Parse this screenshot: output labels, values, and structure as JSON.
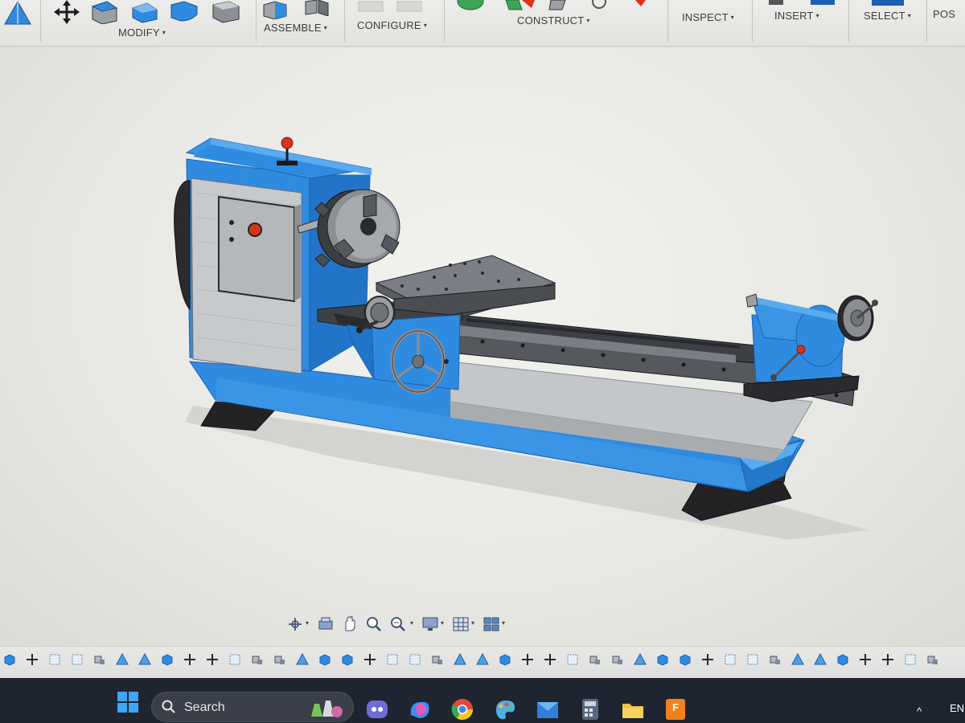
{
  "toolbar": {
    "groups": [
      {
        "label": "MODIFY",
        "caret": "▾"
      },
      {
        "label": "ASSEMBLE",
        "caret": "▾"
      },
      {
        "label": "CONFIGURE",
        "caret": "▾"
      },
      {
        "label": "CONSTRUCT",
        "caret": "▾"
      },
      {
        "label": "INSPECT",
        "caret": "▾"
      },
      {
        "label": "INSERT",
        "caret": "▾"
      },
      {
        "label": "SELECT",
        "caret": "▾"
      },
      {
        "label": "POS",
        "caret": ""
      }
    ],
    "icons": [
      "sketch-icon",
      "move-icon",
      "press-pull-icon",
      "fillet-icon",
      "combine-icon",
      "shell-icon",
      "new-component-icon",
      "joint-icon",
      "configure-icon",
      "offset-plane-icon",
      "inspect-icon",
      "insert-icon",
      "select-icon"
    ]
  },
  "viewport": {
    "model": "lathe-3d-model",
    "colors": {
      "body_blue": "#2f8be0",
      "dark_blue": "#1d5fb0",
      "steel": "#b9bcbf",
      "dark_steel": "#4a4d52",
      "black": "#1f1f22",
      "knob_red": "#d8341c",
      "background": "#ececea"
    }
  },
  "navbar": {
    "icons": [
      "orbit-icon",
      "look-at-icon",
      "pan-icon",
      "zoom-icon",
      "fit-icon",
      "display-settings-icon",
      "grid-settings-icon",
      "viewports-icon"
    ]
  },
  "timeline": {
    "feature_count": 42
  },
  "taskbar": {
    "search_label": "Search",
    "apps": [
      "copilot-icon",
      "teams-icon",
      "chrome-icon",
      "paint-icon",
      "mail-icon",
      "calculator-icon",
      "file-explorer-icon",
      "fusion-icon"
    ],
    "tray_text": "EN",
    "tray_caret": "^"
  }
}
